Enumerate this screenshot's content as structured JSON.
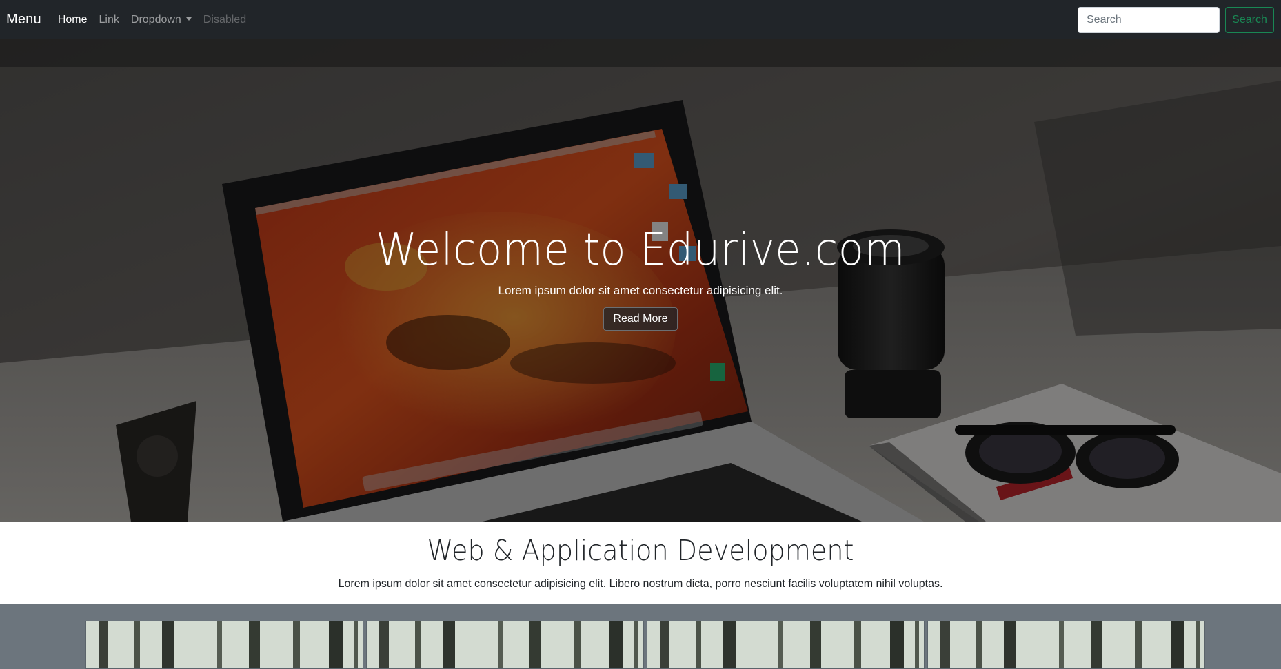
{
  "navbar": {
    "brand": "Menu",
    "links": [
      {
        "label": "Home",
        "state": "active"
      },
      {
        "label": "Link",
        "state": "normal"
      },
      {
        "label": "Dropdown",
        "state": "normal"
      },
      {
        "label": "Disabled",
        "state": "disabled"
      }
    ],
    "search": {
      "placeholder": "Search",
      "value": ""
    },
    "search_button": "Search"
  },
  "hero": {
    "title": "Welcome to Edurive.com",
    "text": "Lorem ipsum dolor sit amet consectetur adipisicing elit.",
    "button": "Read More"
  },
  "intro": {
    "title": "Web & Application Development",
    "text": "Lorem ipsum dolor sit amet consectetur adipisicing elit. Libero nostrum dicta, porro nesciunt facilis voluptatem nihil voluptas."
  },
  "gallery": {
    "cards": [
      {
        "image": "forest-photo"
      },
      {
        "image": "forest-photo"
      },
      {
        "image": "forest-photo"
      },
      {
        "image": "forest-photo"
      }
    ]
  },
  "colors": {
    "navbar_bg": "#212529",
    "success": "#198754",
    "section_bg": "#6c757d",
    "white": "#ffffff"
  }
}
